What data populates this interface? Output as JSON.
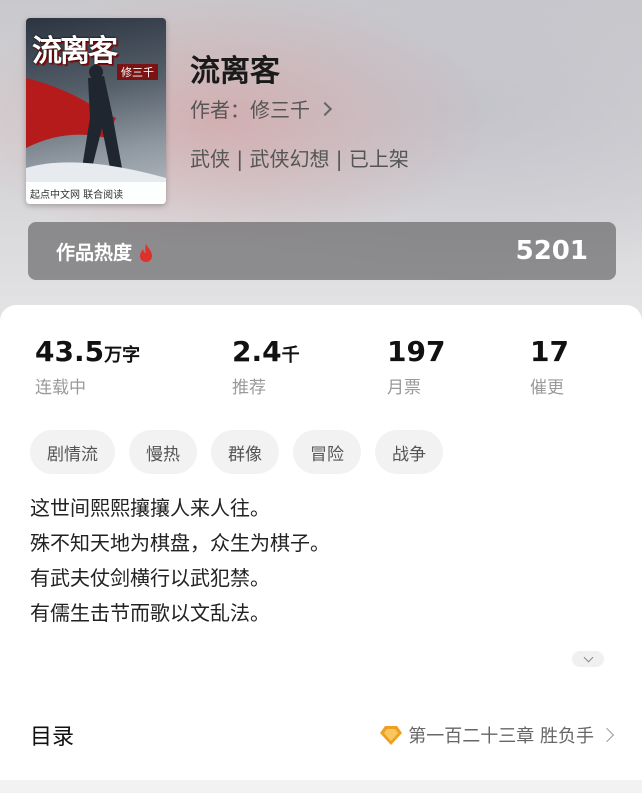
{
  "book": {
    "title": "流离客",
    "author": "作者：修三千",
    "tags": "武侠 | 武侠幻想 | 已上架",
    "cover": {
      "title": "流离客",
      "author": "修三千",
      "publisher": "起点中文网  联合阅读"
    }
  },
  "heat": {
    "label": "作品热度",
    "value": "5201"
  },
  "stats": [
    {
      "value": "43.5",
      "unit": "万字",
      "label": "连载中"
    },
    {
      "value": "2.4",
      "unit": "千",
      "label": "推荐"
    },
    {
      "value": "197",
      "unit": "",
      "label": "月票"
    },
    {
      "value": "17",
      "unit": "",
      "label": "催更"
    }
  ],
  "chips": [
    "剧情流",
    "慢热",
    "群像",
    "冒险",
    "战争"
  ],
  "intro": [
    "这世间熙熙攘攘人来人往。",
    "殊不知天地为棋盘，众生为棋子。",
    "有武夫仗剑横行以武犯禁。",
    "有儒生击节而歌以文乱法。"
  ],
  "toc": {
    "title": "目录",
    "latest": "第一百二十三章 胜负手"
  },
  "icons": {
    "heat": "flame-icon",
    "author_chevron": "chevron-right-icon",
    "expand": "chevron-down-icon",
    "toc_badge": "heart-badge-icon",
    "toc_chevron": "chevron-right-icon"
  },
  "colors": {
    "flame": "#e0302a",
    "badge": "#f0a020",
    "heat_bg": "#5a5a5c"
  }
}
